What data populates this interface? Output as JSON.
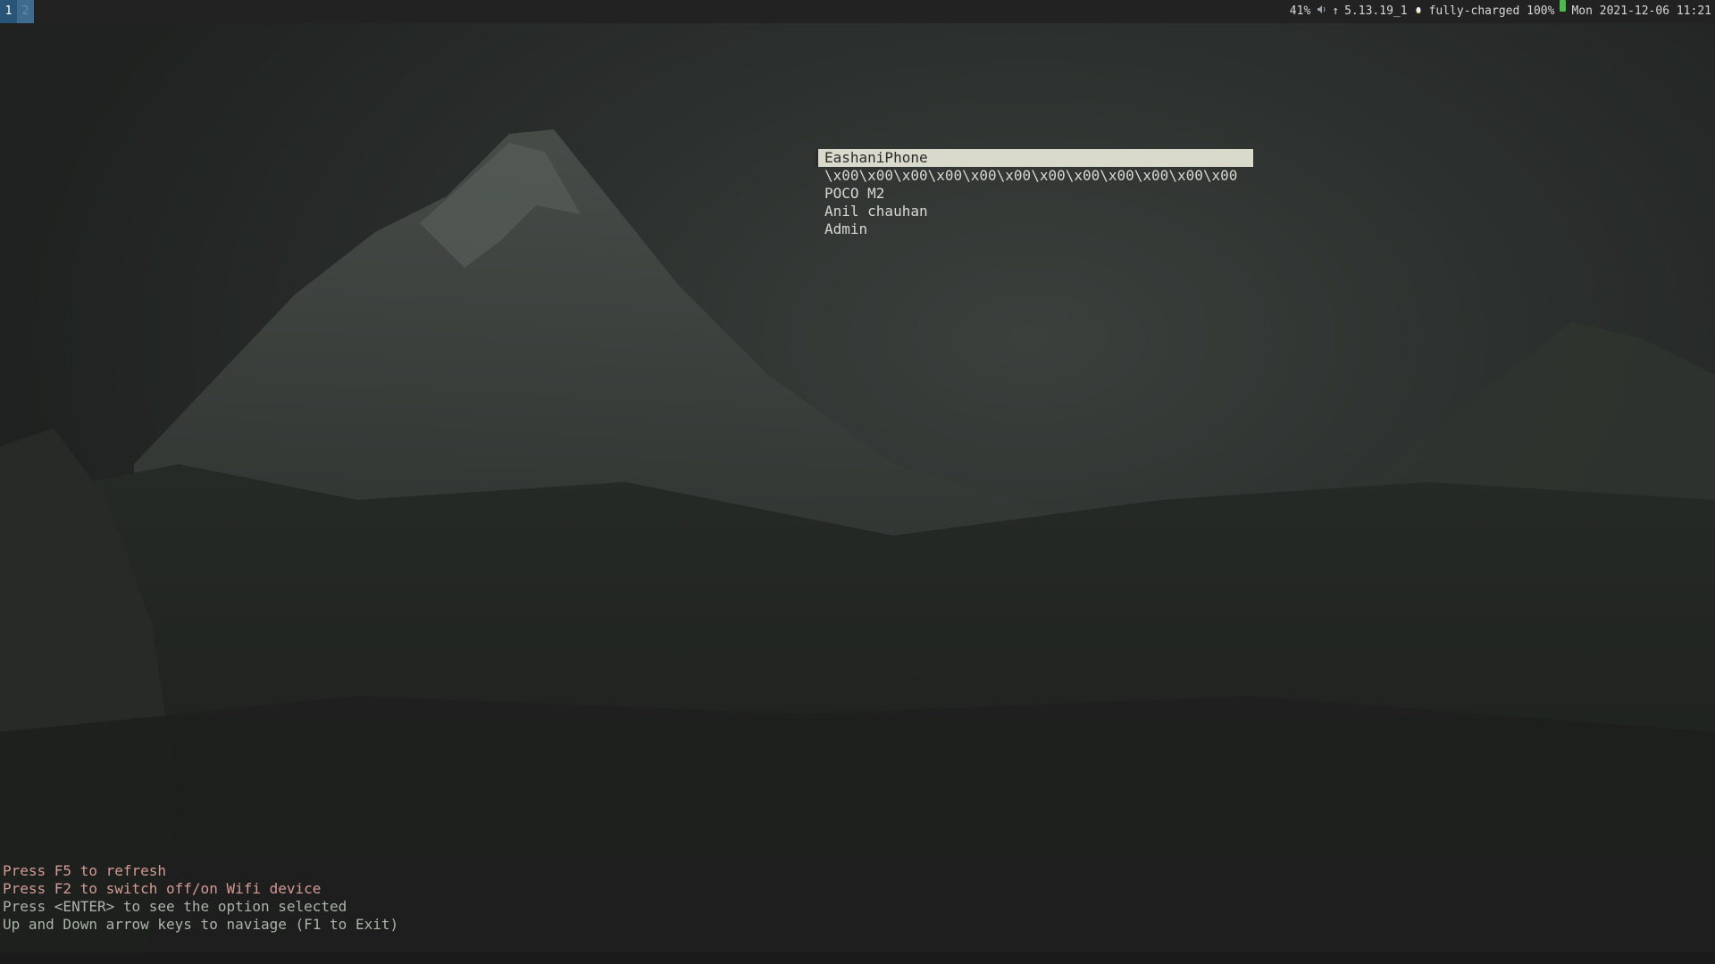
{
  "topbar": {
    "workspaces": [
      {
        "label": "1",
        "active": true
      },
      {
        "label": "2",
        "active": false
      }
    ],
    "volume": "41%",
    "volume_icon": "speaker-icon",
    "kernel_arrow": "↑",
    "kernel": "5.13.19_1",
    "os_icon": "linux-penguin-icon",
    "battery": "fully-charged 100%",
    "battery_icon": "battery-icon",
    "datetime": "Mon 2021-12-06 11:21"
  },
  "menu": {
    "items": [
      {
        "label": "EashaniPhone",
        "selected": true
      },
      {
        "label": "\\x00\\x00\\x00\\x00\\x00\\x00\\x00\\x00\\x00\\x00\\x00\\x00",
        "selected": false
      },
      {
        "label": "POCO M2",
        "selected": false
      },
      {
        "label": "Anil chauhan",
        "selected": false
      },
      {
        "label": "Admin",
        "selected": false
      }
    ]
  },
  "help": {
    "refresh": "Press F5 to refresh",
    "wifi_toggle": "Press F2 to switch off/on Wifi device",
    "enter": "Press <ENTER> to see the option selected",
    "navigate": "Up and Down arrow keys to naviage (F1 to Exit)"
  },
  "colors": {
    "selected_bg": "#d9d9cc",
    "menu_text": "#d8d8d0",
    "help_pink": "#d49a94",
    "help_gray": "#aab4a8",
    "workspace_active": "#285577"
  }
}
